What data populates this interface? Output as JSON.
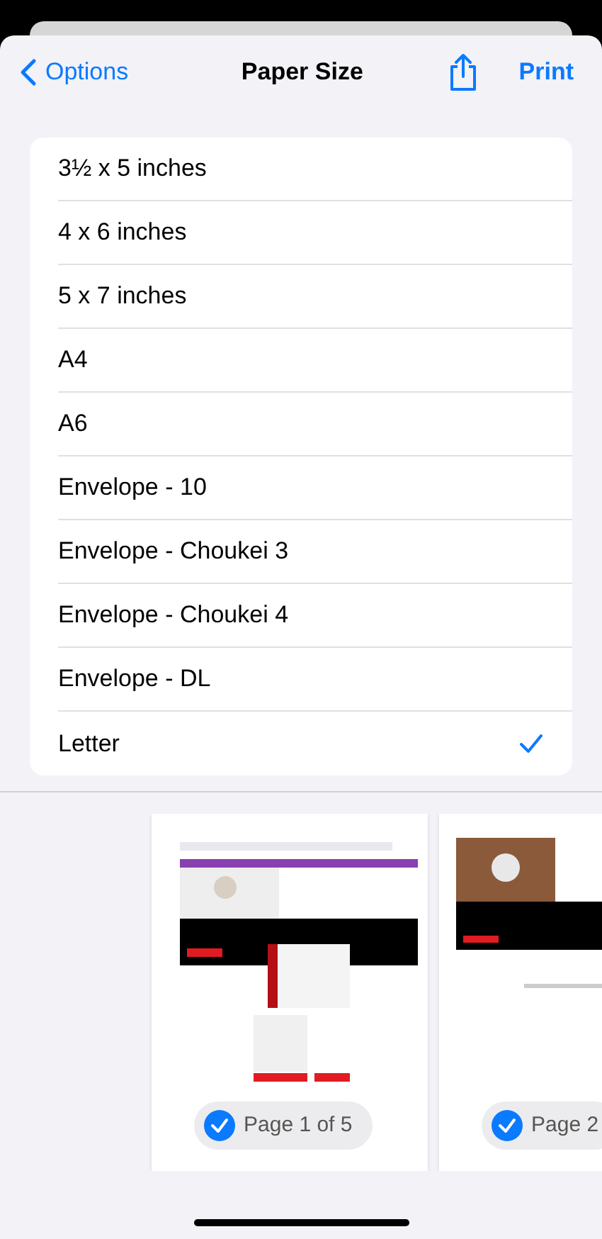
{
  "nav": {
    "back": "Options",
    "title": "Paper Size",
    "action": "Print"
  },
  "sizes": [
    {
      "label": "3½ x 5 inches",
      "selected": false
    },
    {
      "label": "4 x 6 inches",
      "selected": false
    },
    {
      "label": "5 x 7 inches",
      "selected": false
    },
    {
      "label": "A4",
      "selected": false
    },
    {
      "label": "A6",
      "selected": false
    },
    {
      "label": "Envelope - 10",
      "selected": false
    },
    {
      "label": "Envelope - Choukei 3",
      "selected": false
    },
    {
      "label": "Envelope - Choukei 4",
      "selected": false
    },
    {
      "label": "Envelope - DL",
      "selected": false
    },
    {
      "label": "Letter",
      "selected": true
    }
  ],
  "pages": [
    {
      "label": "Page 1 of 5",
      "selected": true
    },
    {
      "label": "Page 2",
      "selected": true
    }
  ]
}
